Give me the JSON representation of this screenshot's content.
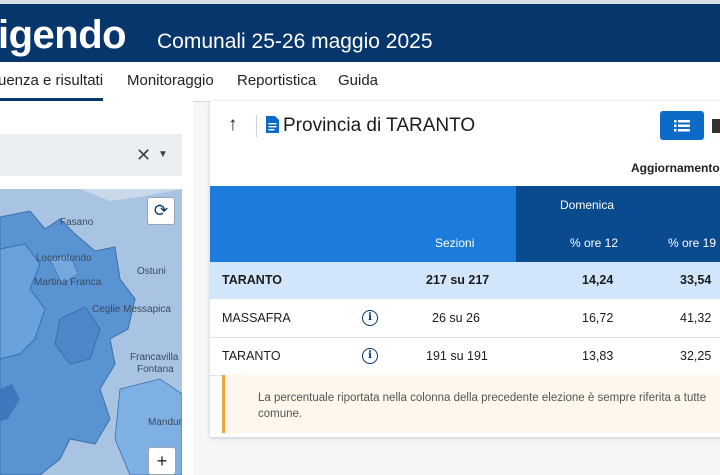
{
  "header": {
    "brand": "igendo",
    "subtitle": "Comunali 25-26 maggio 2025"
  },
  "nav": {
    "items": [
      {
        "label": "uenza e risultati",
        "active": true
      },
      {
        "label": "Monitoraggio",
        "active": false
      },
      {
        "label": "Reportistica",
        "active": false
      },
      {
        "label": "Guida",
        "active": false
      }
    ]
  },
  "select": {
    "value": "",
    "clear_icon": "close-icon",
    "caret_icon": "chevron-down-icon"
  },
  "map": {
    "labels": [
      "Fasano",
      "Locorotondo",
      "Ostuni",
      "Martina Franca",
      "Ceglie Messapica",
      "Francavilla",
      "Fontana",
      "Manduria"
    ],
    "refresh_icon": "refresh-icon",
    "zoom_in_label": "+"
  },
  "card": {
    "title": "Provincia di TARANTO",
    "updated_label": "Aggiornamento:",
    "table": {
      "group_header": "Domenica",
      "col_sezioni": "Sezioni",
      "col_ore12": "% ore 12",
      "col_ore19": "% ore 19",
      "rows": [
        {
          "name": "TARANTO",
          "sezioni": "217 su 217",
          "ore12": "14,24",
          "ore19": "33,54"
        },
        {
          "name": "MASSAFRA",
          "sezioni": "26 su 26",
          "ore12": "16,72",
          "ore19": "41,32"
        },
        {
          "name": "TARANTO",
          "sezioni": "191 su 191",
          "ore12": "13,83",
          "ore19": "32,25"
        }
      ]
    },
    "note": "La percentuale riportata nella colonna della precedente elezione è sempre riferita a tutte comune."
  },
  "colors": {
    "header_bg": "#06366b",
    "table_header": "#1b7cdb",
    "table_header_dark": "#0a4a8f",
    "total_row": "#d1e6fb",
    "note_accent": "#f0a43a"
  }
}
